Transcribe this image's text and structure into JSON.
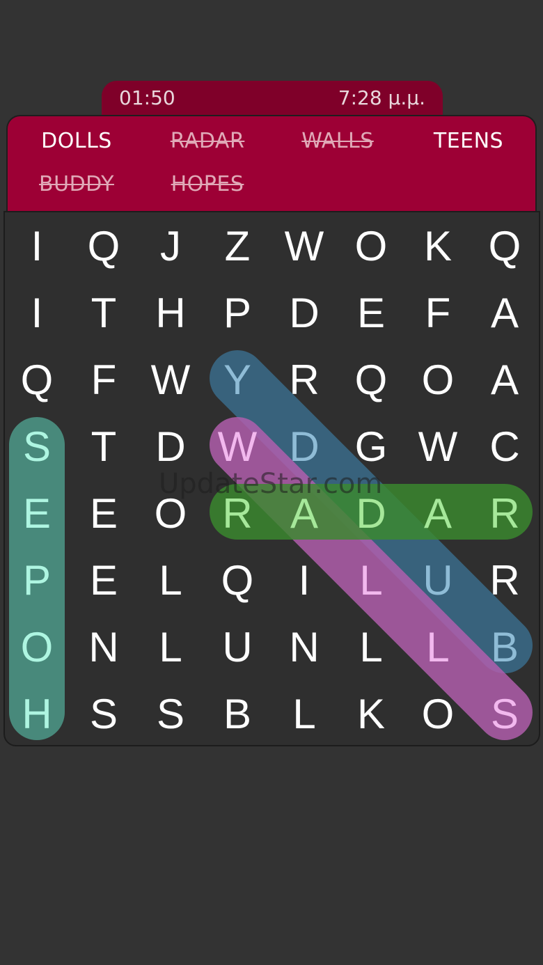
{
  "status": {
    "timer": "01:50",
    "clock": "7:28 μ.μ."
  },
  "words": [
    {
      "text": "DOLLS",
      "found": false
    },
    {
      "text": "RADAR",
      "found": true
    },
    {
      "text": "WALLS",
      "found": true
    },
    {
      "text": "TEENS",
      "found": false
    },
    {
      "text": "BUDDY",
      "found": true
    },
    {
      "text": "HOPES",
      "found": true
    }
  ],
  "grid": [
    [
      "I",
      "Q",
      "J",
      "Z",
      "W",
      "O",
      "K",
      "Q"
    ],
    [
      "I",
      "T",
      "H",
      "P",
      "D",
      "E",
      "F",
      "A"
    ],
    [
      "Q",
      "F",
      "W",
      "Y",
      "R",
      "Q",
      "O",
      "A"
    ],
    [
      "S",
      "T",
      "D",
      "W",
      "D",
      "G",
      "W",
      "C"
    ],
    [
      "E",
      "E",
      "O",
      "R",
      "A",
      "D",
      "A",
      "R"
    ],
    [
      "P",
      "E",
      "L",
      "Q",
      "I",
      "L",
      "U",
      "R"
    ],
    [
      "O",
      "N",
      "L",
      "U",
      "N",
      "L",
      "L",
      "B"
    ],
    [
      "H",
      "S",
      "S",
      "B",
      "L",
      "K",
      "O",
      "S"
    ]
  ],
  "highlights": [
    {
      "word": "HOPES",
      "from": [
        7,
        0
      ],
      "to": [
        3,
        0
      ],
      "color": "#4e9e8c",
      "text_color": "#aef5e1"
    },
    {
      "word": "BUDDY",
      "from": [
        6,
        7
      ],
      "to": [
        2,
        3
      ],
      "color": "#3b6e8e",
      "text_color": "#8fbcd6"
    },
    {
      "word": "WALLS",
      "from": [
        3,
        3
      ],
      "to": [
        7,
        7
      ],
      "color": "#b55fb0",
      "text_color": "#f2b8ee"
    },
    {
      "word": "RADAR",
      "from": [
        4,
        3
      ],
      "to": [
        4,
        7
      ],
      "color": "#3b8a2e",
      "text_color": "#a6e89a"
    }
  ],
  "watermark": "UpdateStar.com"
}
